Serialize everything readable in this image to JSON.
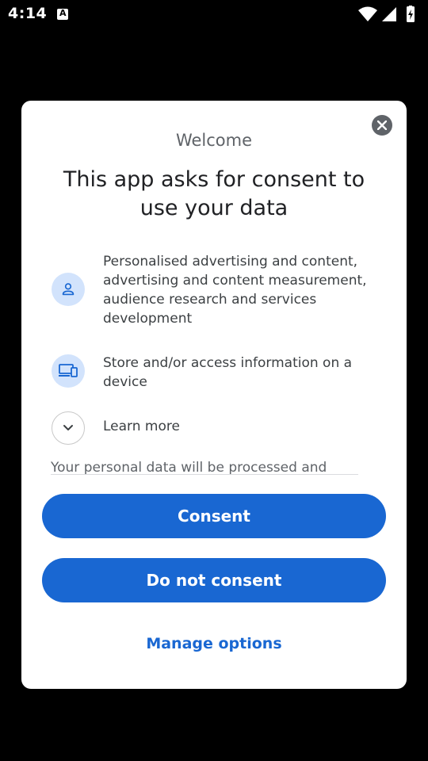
{
  "status_bar": {
    "time": "4:14",
    "icons": [
      "notification-a-icon",
      "wifi-icon",
      "signal-icon",
      "battery-charging-icon"
    ]
  },
  "dialog": {
    "welcome": "Welcome",
    "title": "This app asks for consent to use your data",
    "purposes": [
      {
        "icon": "person-icon",
        "text": "Personalised advertising and content, advertising and content measurement, audience research and services development"
      },
      {
        "icon": "devices-icon",
        "text": "Store and/or access information on a device"
      }
    ],
    "learn_more": "Learn more",
    "body_text": "Your personal data will be processed and",
    "buttons": {
      "consent": "Consent",
      "do_not_consent": "Do not consent",
      "manage_options": "Manage options"
    },
    "colors": {
      "accent": "#1967d2",
      "icon_bg": "#d2e3fc"
    }
  }
}
